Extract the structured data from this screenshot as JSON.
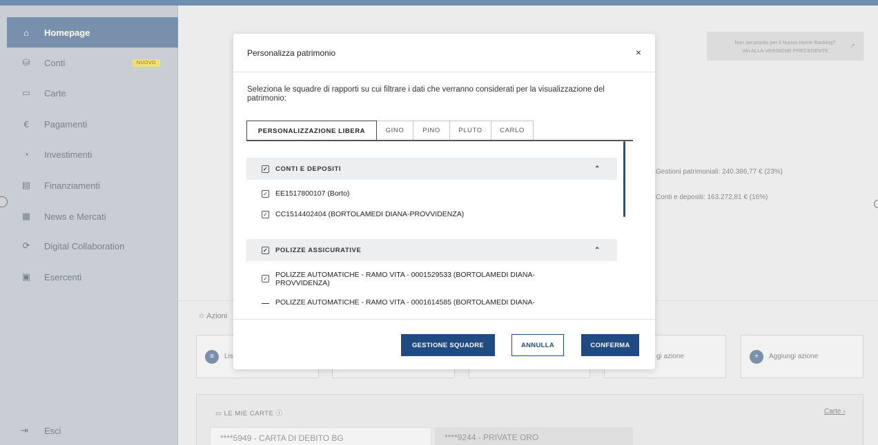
{
  "sidebar": {
    "items": [
      {
        "label": "Homepage",
        "icon": "home-icon",
        "glyph": "⌂"
      },
      {
        "label": "Conti",
        "icon": "database-icon",
        "glyph": "⛁"
      },
      {
        "label": "Carte",
        "icon": "card-icon",
        "glyph": "▭"
      },
      {
        "label": "Pagamenti",
        "icon": "euro-icon",
        "glyph": "€"
      },
      {
        "label": "Investimenti",
        "icon": "pie-icon",
        "glyph": "◔"
      },
      {
        "label": "Finanziamenti",
        "icon": "money-icon",
        "glyph": "▤"
      },
      {
        "label": "News e Mercati",
        "icon": "news-icon",
        "glyph": "▦"
      },
      {
        "label": "Digital Collaboration",
        "icon": "handshake-icon",
        "glyph": "⟳"
      },
      {
        "label": "Esercenti",
        "icon": "store-icon",
        "glyph": "▣"
      }
    ],
    "badge": "NUOVO",
    "exit_label": "Esci",
    "exit_glyph": "⇥"
  },
  "background": {
    "old_version_line1": "Non sei pronto per il Nuovo Home Banking?",
    "old_version_line2": "VAI ALLA VERSIONE PRECEDENTE",
    "stat_gestioni": "Gestioni patrimoniali: 240.386,77 € (23%)",
    "stat_conti": "Conti e depositi: 163.272,81 € (16%)",
    "azioni_title": "☆ Azioni",
    "action_list": "List",
    "action_add_partial": "gi azione",
    "action_add": "Aggiungi azione",
    "cards_title": "▭ LE MIE CARTE ⓘ",
    "carte_link": "Carte ›",
    "card1": "****5949 - CARTA DI DEBITO BG",
    "card2": "****9244 - PRIVATE ORO"
  },
  "modal": {
    "title": "Personalizza patrimonio",
    "close": "×",
    "description": "Seleziona le squadre di rapporti su cui filtrare i dati che verranno considerati per la visualizzazione del patrimonio:",
    "tabs": [
      "PERSONALIZZAZIONE LIBERA",
      "GINO",
      "PINO",
      "PLUTO",
      "CARLO"
    ],
    "groups": [
      {
        "label": "CONTI E DEPOSITI",
        "items": [
          "EE1517800107 (Borto)",
          "CC1514402404 (BORTOLAMEDI DIANA-PROVVIDENZA)"
        ]
      },
      {
        "label": "POLIZZE ASSICURATIVE",
        "items": [
          "POLIZZE AUTOMATICHE - RAMO VITA - 0001529533 (BORTOLAMEDI DIANA-PROVVIDENZA)",
          "POLIZZE AUTOMATICHE - RAMO VITA - 0001614585 (BORTOLAMEDI DIANA-"
        ]
      }
    ],
    "check_glyph": "✓",
    "chevron_up": "⌃",
    "buttons": {
      "gestione": "GESTIONE SQUADRE",
      "annulla": "ANNULLA",
      "conferma": "CONFERMA"
    }
  }
}
